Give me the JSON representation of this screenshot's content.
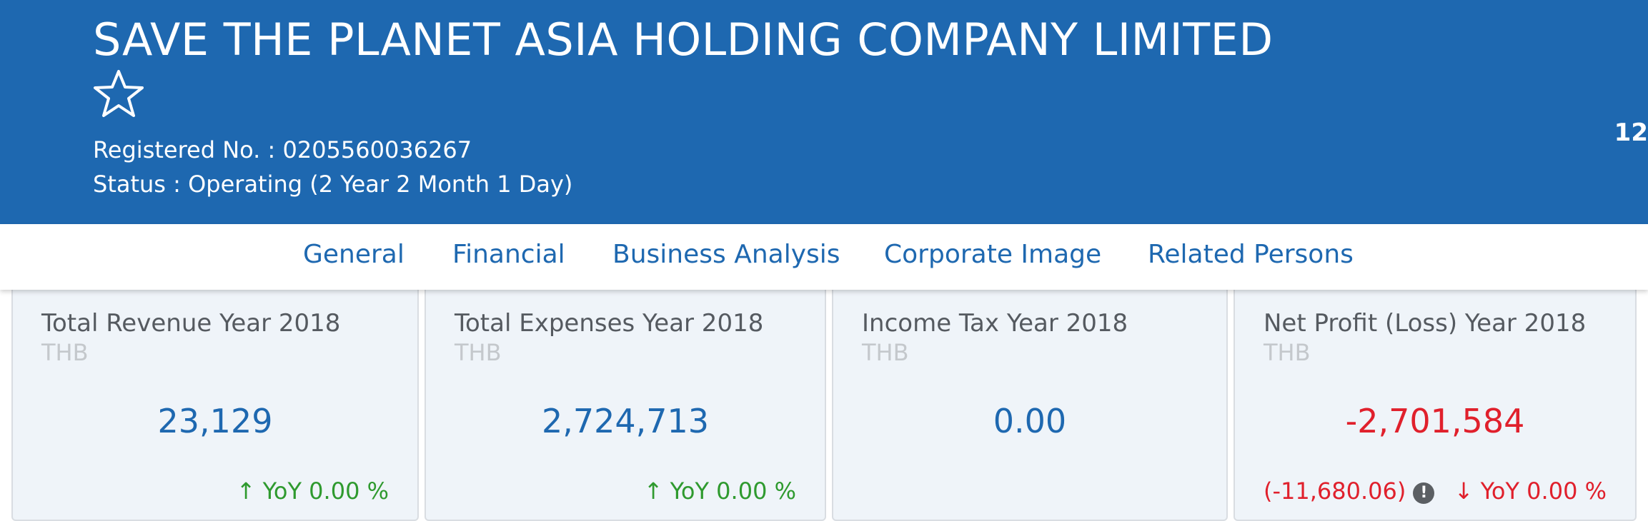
{
  "header": {
    "company_name": "SAVE THE PLANET ASIA HOLDING COMPANY LIMITED",
    "favorite_icon": "star-outline-icon",
    "registered_no": "Registered No. : 0205560036267",
    "status": "Status : Operating (2 Year 2 Month 1 Day)",
    "corner_number": "12",
    "background_color": "#1e68b0"
  },
  "tabs": [
    {
      "label": "General"
    },
    {
      "label": "Financial"
    },
    {
      "label": "Business Analysis"
    },
    {
      "label": "Corporate Image"
    },
    {
      "label": "Related Persons"
    }
  ],
  "cards": [
    {
      "title": "Total Revenue Year 2018",
      "unit": "THB",
      "value": "23,129",
      "yoy": "YoY 0.00 %",
      "yoy_direction": "up",
      "yoy_arrow": "↑"
    },
    {
      "title": "Total Expenses Year 2018",
      "unit": "THB",
      "value": "2,724,713",
      "yoy": "YoY 0.00 %",
      "yoy_direction": "up",
      "yoy_arrow": "↑"
    },
    {
      "title": "Income Tax Year 2018",
      "unit": "THB",
      "value": "0.00"
    },
    {
      "title": "Net Profit (Loss) Year 2018",
      "unit": "THB",
      "value": "-2,701,584",
      "delta": "(-11,680.06)",
      "info_icon": "!",
      "yoy": "YoY 0.00 %",
      "yoy_direction": "down",
      "yoy_arrow": "↓"
    }
  ],
  "colors": {
    "accent_blue": "#1e68b0",
    "positive_green": "#2f9a2f",
    "negative_red": "#e0202c",
    "card_background": "#eff4f9"
  }
}
